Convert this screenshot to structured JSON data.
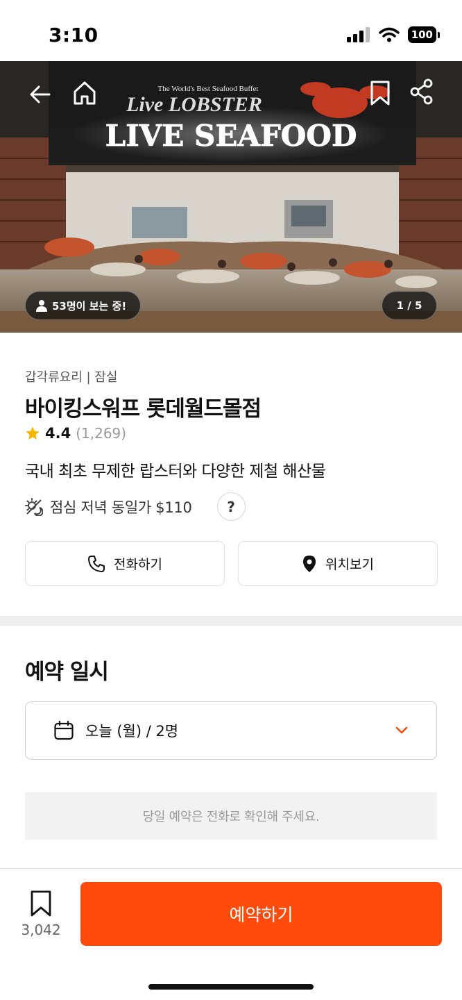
{
  "status_bar": {
    "time": "3:10",
    "battery": "100"
  },
  "hero": {
    "sign_line1": "The World's Best Seafood Buffet",
    "sign_line2": "Live LOBSTER",
    "sign_main": "LIVE SEAFOOD",
    "viewers": "53명이 보는 중!",
    "counter": "1 / 5"
  },
  "restaurant": {
    "category": "갑각류요리 | 잠실",
    "name": "바이킹스워프 롯데월드몰점",
    "rating": "4.4",
    "rating_count": "(1,269)",
    "description": "국내 최초 무제한 랍스터와 다양한 제철 해산물",
    "price": "점심 저녁 동일가 $110",
    "help": "?"
  },
  "actions": {
    "call": "전화하기",
    "location": "위치보기"
  },
  "reservation": {
    "title": "예약 일시",
    "date_value": "오늘 (월) / 2명",
    "notice": "당일 예약은 전화로 확인해 주세요."
  },
  "bottom": {
    "save_count": "3,042",
    "reserve": "예약하기"
  },
  "colors": {
    "accent": "#ff4a0b",
    "star": "#f7b500"
  }
}
